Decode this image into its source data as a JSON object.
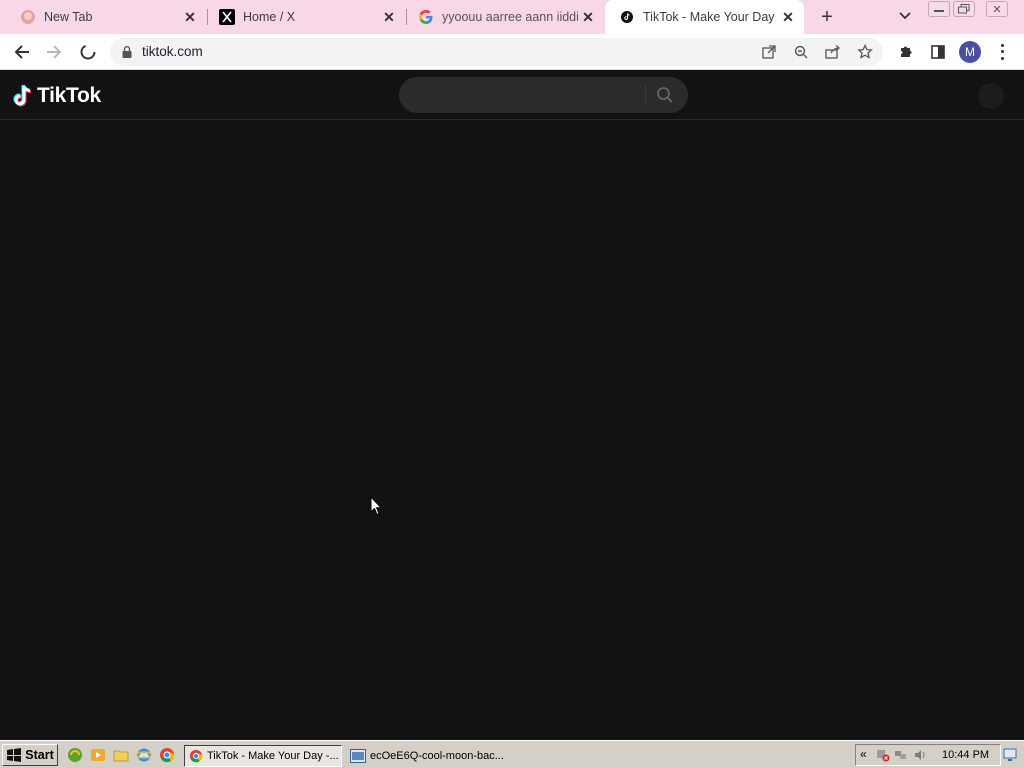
{
  "browser": {
    "tabs": [
      {
        "title": "New Tab",
        "icon": "new-tab-favicon",
        "active": false
      },
      {
        "title": "Home / X",
        "icon": "x-logo-icon",
        "active": false
      },
      {
        "title": "yyoouu aarree aann iiddiioott",
        "icon": "google-g-icon",
        "active": false
      },
      {
        "title": "TikTok - Make Your Day",
        "icon": "tiktok-favicon",
        "active": true
      }
    ],
    "url": "tiktok.com"
  },
  "tiktok": {
    "logo_text": "TikTok",
    "search": {
      "placeholder": ""
    }
  },
  "taskbar": {
    "start_label": "Start",
    "tasks": [
      {
        "label": "TikTok - Make Your Day -...",
        "active": true
      },
      {
        "label": "ecOeE6Q-cool-moon-bac...",
        "active": false
      }
    ],
    "clock": "10:44 PM"
  },
  "colors": {
    "tab_strip": "#f8d7e6",
    "page_bg": "#121212",
    "search_bg": "#2b2b2b",
    "taskbar": "#d4d0c8"
  }
}
